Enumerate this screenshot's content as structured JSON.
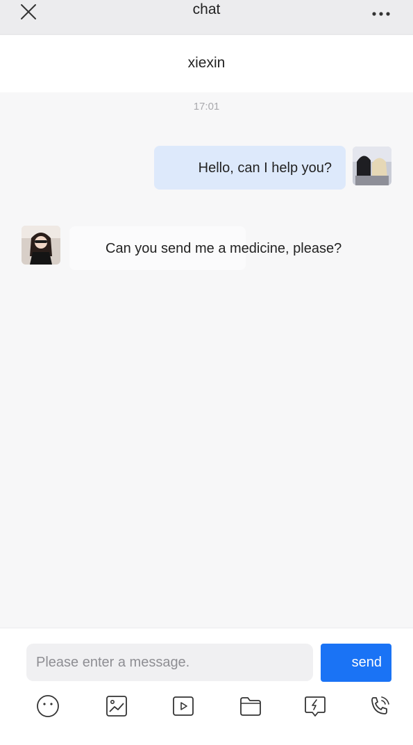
{
  "header": {
    "title": "chat",
    "close_icon": "close-icon",
    "more_icon": "more-dots-icon"
  },
  "contact": {
    "name": "xiexin"
  },
  "conversation": {
    "timestamp": "17:01",
    "messages": [
      {
        "direction": "outgoing",
        "text": "Hello, can I help you?"
      },
      {
        "direction": "incoming",
        "text": "Can you send me a medicine, please?"
      }
    ]
  },
  "composer": {
    "placeholder": "Please enter a message.",
    "value": "",
    "send_label": "send",
    "tools": [
      "emoji-icon",
      "image-icon",
      "video-icon",
      "folder-icon",
      "quick-reply-icon",
      "phone-icon"
    ]
  },
  "colors": {
    "accent": "#1a73f5",
    "outgoing_bubble": "#dde9fb",
    "incoming_bubble": "#fbfbfc",
    "background": "#f7f7f8"
  }
}
